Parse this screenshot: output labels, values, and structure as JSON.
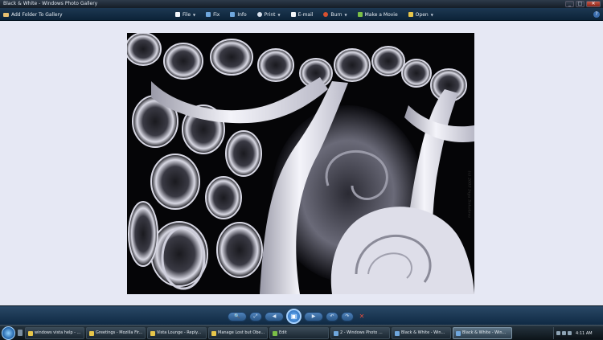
{
  "window": {
    "title": "Black & White - Windows Photo Gallery"
  },
  "commandbar": {
    "add_folder": "Add Folder To Gallery",
    "items": [
      {
        "label": "File",
        "icon": "file-icon",
        "caret": true
      },
      {
        "label": "Fix",
        "icon": "fix-icon",
        "caret": false
      },
      {
        "label": "Info",
        "icon": "info-icon",
        "caret": false
      },
      {
        "label": "Print",
        "icon": "print-icon",
        "caret": true
      },
      {
        "label": "E-mail",
        "icon": "email-icon",
        "caret": false
      },
      {
        "label": "Burn",
        "icon": "burn-icon",
        "caret": true
      },
      {
        "label": "Make a Movie",
        "icon": "movie-icon",
        "caret": false
      },
      {
        "label": "Open",
        "icon": "open-icon",
        "caret": true
      }
    ],
    "help": "?"
  },
  "photo": {
    "watermark": "(c) 2009 Inga Sokolova",
    "colors": {
      "dark": "#000000",
      "light": "#e4e4ee",
      "mid": "#8a8a98"
    }
  },
  "controls": {
    "glyphs": {
      "zoom": "🔍",
      "fit": "⤢",
      "previous": "◀",
      "slideshow": "▣",
      "next": "▶",
      "rotate_ccw": "↶",
      "rotate_cw": "↷",
      "delete": "✕"
    }
  },
  "taskbar": {
    "tasks": [
      {
        "label": "windows vista help - ...",
        "active": false
      },
      {
        "label": "Greetings - Mozilla Fir...",
        "active": false
      },
      {
        "label": "Vista Lounge - Reply...",
        "active": false
      },
      {
        "label": "Manage Lost but Obe...",
        "active": false
      },
      {
        "label": "Edit",
        "active": false
      },
      {
        "label": "2 - Windows Photo ...",
        "active": false
      },
      {
        "label": "Black & White - Win...",
        "active": false
      },
      {
        "label": "Black & White - Win...",
        "active": true
      }
    ],
    "clock": "4:11 AM"
  }
}
